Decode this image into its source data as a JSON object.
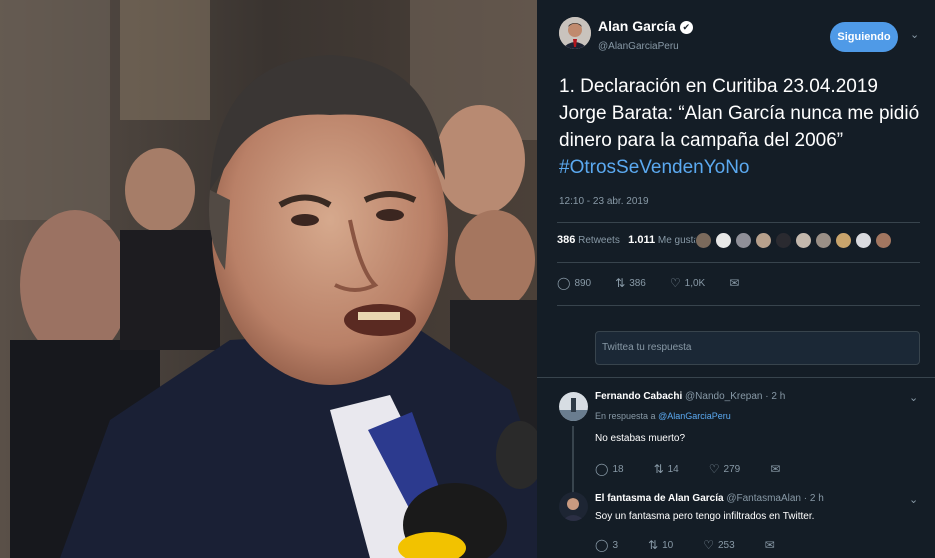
{
  "tweet": {
    "author_name": "Alan García",
    "verified_mark": "✔",
    "author_handle": "@AlanGarciaPeru",
    "follow_label": "Siguiendo",
    "text": "1. Declaración en Curitiba 23.04.2019 Jorge Barata: “Alan García nunca me pidió dinero para la campaña del 2006”",
    "hashtag": "#OtrosSeVendenYoNo",
    "timestamp": "12:10 - 23 abr. 2019",
    "retweets_count": "386",
    "retweets_label": "Retweets",
    "likes_count": "1.011",
    "likes_label": "Me gusta",
    "actions": {
      "reply_count": "890",
      "retweet_count": "386",
      "like_count": "1,0K"
    }
  },
  "reply_box": {
    "placeholder": "Twittea tu respuesta"
  },
  "replies": [
    {
      "name": "Fernando Cabachi",
      "handle": "@Nando_Krepan",
      "time": "· 2 h",
      "reply_to_prefix": "En respuesta a",
      "reply_to_handle": "@AlanGarciaPeru",
      "text": "No estabas muerto?",
      "reply_count": "18",
      "retweet_count": "14",
      "like_count": "279"
    },
    {
      "name": "El fantasma de Alan García",
      "handle": "@FantasmaAlan",
      "time": "· 2 h",
      "text": "Soy un fantasma pero tengo infiltrados en Twitter.",
      "reply_count": "3",
      "retweet_count": "10",
      "like_count": "253"
    }
  ],
  "icons": {
    "reply": "reply-icon",
    "retweet": "retweet-icon",
    "like": "heart-icon",
    "dm": "message-icon",
    "more": "chevron-down-icon"
  },
  "colors": {
    "panel_bg": "#141d26",
    "accent": "#5ba9f0",
    "button": "#4f9ae7",
    "muted": "#8899a6"
  }
}
